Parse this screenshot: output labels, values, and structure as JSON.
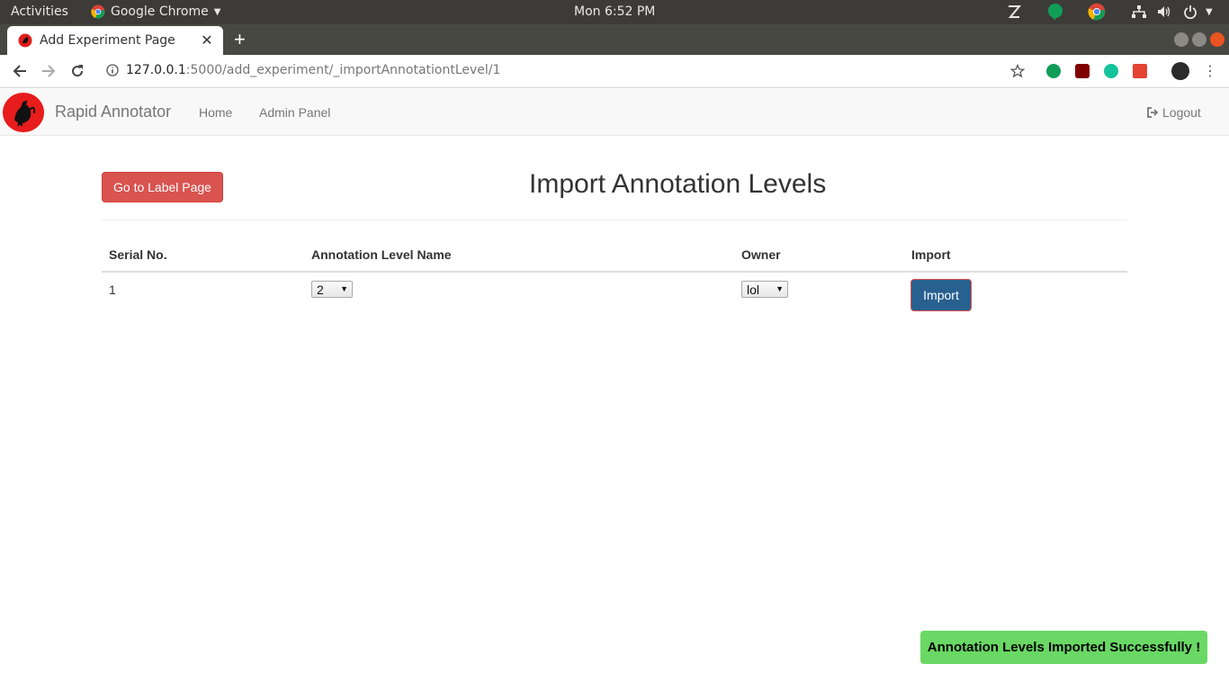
{
  "os_bar": {
    "activities": "Activities",
    "app_name": "Google Chrome",
    "clock": "Mon  6:52 PM",
    "icons": [
      "zotero-icon",
      "hangouts-icon",
      "chrome-icon",
      "network-icon",
      "volume-icon",
      "power-icon",
      "chevron-down-icon"
    ]
  },
  "browser": {
    "tab_title": "Add Experiment Page",
    "url_host": "127.0.0.1",
    "url_path": ":5000/add_experiment/_importAnnotationtLevel/1",
    "extensions": [
      "hangouts-ext-icon",
      "ublock-icon",
      "grammarly-icon",
      "todoist-icon",
      "profile-avatar"
    ]
  },
  "navbar": {
    "brand": "Rapid Annotator",
    "links": [
      "Home",
      "Admin Panel"
    ],
    "logout": "Logout"
  },
  "main": {
    "label_button": "Go to Label Page",
    "title": "Import Annotation Levels",
    "table": {
      "headers": [
        "Serial No.",
        "Annotation Level Name",
        "Owner",
        "Import"
      ],
      "rows": [
        {
          "serial": "1",
          "level_name": "2",
          "owner": "lol",
          "action": "Import"
        }
      ]
    }
  },
  "toast": "Annotation Levels Imported Successfully !",
  "colors": {
    "danger": "#d9534f",
    "primary": "#286090",
    "success_toast": "#6ad865",
    "os_bar": "#3c3b37"
  }
}
